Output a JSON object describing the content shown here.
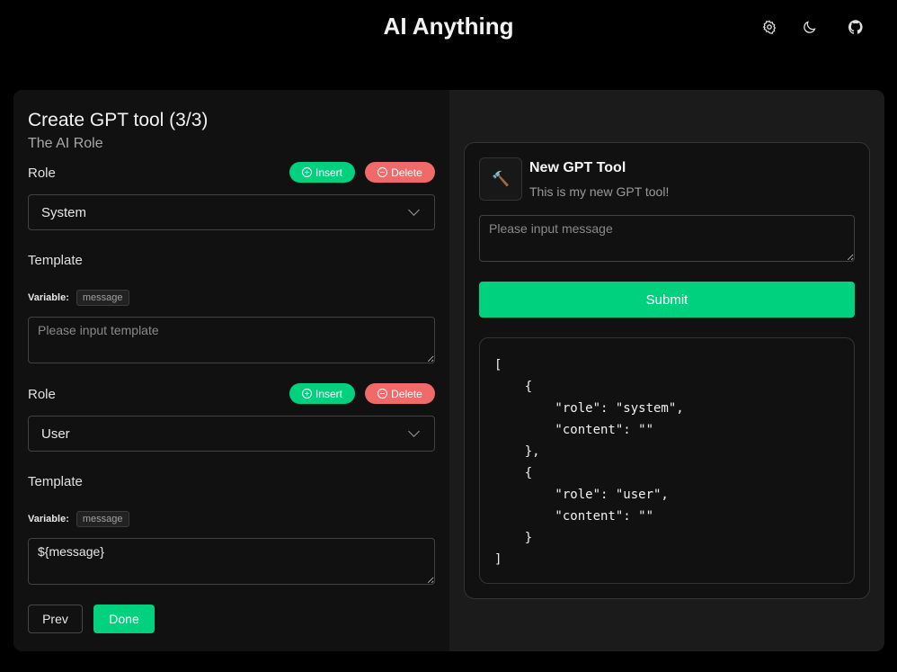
{
  "header": {
    "title": "AI Anything",
    "icons": [
      "settings-icon",
      "moon-icon",
      "github-icon"
    ]
  },
  "form": {
    "title": "Create GPT tool (3/3)",
    "subtitle": "The AI Role",
    "blocks": [
      {
        "role_label": "Role",
        "insert_label": "Insert",
        "delete_label": "Delete",
        "role_value": "System",
        "template_label": "Template",
        "variable_label": "Variable:",
        "variable_tag": "message",
        "template_value": "",
        "template_placeholder": "Please input template"
      },
      {
        "role_label": "Role",
        "insert_label": "Insert",
        "delete_label": "Delete",
        "role_value": "User",
        "template_label": "Template",
        "variable_label": "Variable:",
        "variable_tag": "message",
        "template_value": "${message}",
        "template_placeholder": "Please input template"
      }
    ],
    "prev_label": "Prev",
    "done_label": "Done"
  },
  "preview": {
    "tool_icon": "🔨",
    "tool_name": "New GPT Tool",
    "tool_description": "This is my new GPT tool!",
    "message_placeholder": "Please input message",
    "submit_label": "Submit",
    "output_json": "[\n    {\n        \"role\": \"system\",\n        \"content\": \"\"\n    },\n    {\n        \"role\": \"user\",\n        \"content\": \"\"\n    }\n]"
  },
  "colors": {
    "accent": "#00d17f",
    "danger": "#f06a6a",
    "background": "#000000",
    "panel": "#111111"
  }
}
